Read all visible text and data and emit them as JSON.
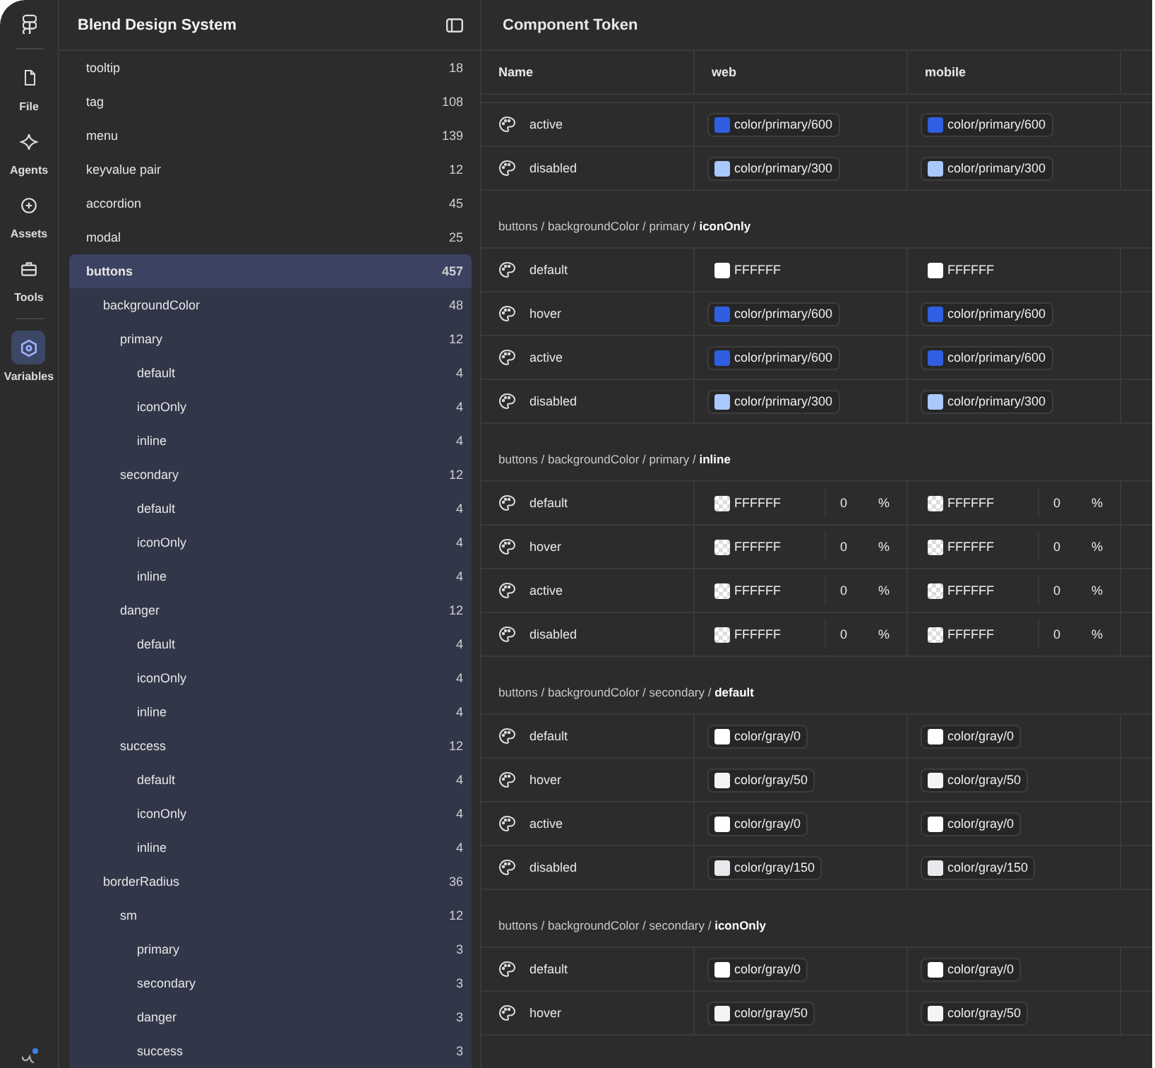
{
  "rail": {
    "items": [
      {
        "label": "File",
        "selected": false,
        "kind": "file"
      },
      {
        "label": "Agents",
        "selected": false,
        "kind": "agents"
      },
      {
        "label": "Assets",
        "selected": false,
        "kind": "assets"
      },
      {
        "label": "Tools",
        "selected": false,
        "kind": "tools"
      },
      {
        "label": "Variables",
        "selected": true,
        "kind": "variables"
      }
    ]
  },
  "sidebar": {
    "title": "Blend Design System",
    "tree": [
      {
        "label": "tooltip",
        "count": "18",
        "selected": false
      },
      {
        "label": "tag",
        "count": "108",
        "selected": false
      },
      {
        "label": "menu",
        "count": "139",
        "selected": false
      },
      {
        "label": "keyvalue pair",
        "count": "12",
        "selected": false
      },
      {
        "label": "accordion",
        "count": "45",
        "selected": false
      },
      {
        "label": "modal",
        "count": "25",
        "selected": false
      },
      {
        "label": "buttons",
        "count": "457",
        "selected": true,
        "children": [
          {
            "label": "backgroundColor",
            "count": "48",
            "selected": false,
            "children": [
              {
                "label": "primary",
                "count": "12",
                "selected": false,
                "children": [
                  {
                    "label": "default",
                    "count": "4",
                    "selected": false
                  },
                  {
                    "label": "iconOnly",
                    "count": "4",
                    "selected": false
                  },
                  {
                    "label": "inline",
                    "count": "4",
                    "selected": false
                  }
                ]
              },
              {
                "label": "secondary",
                "count": "12",
                "selected": false,
                "children": [
                  {
                    "label": "default",
                    "count": "4",
                    "selected": false
                  },
                  {
                    "label": "iconOnly",
                    "count": "4",
                    "selected": false
                  },
                  {
                    "label": "inline",
                    "count": "4",
                    "selected": false
                  }
                ]
              },
              {
                "label": "danger",
                "count": "12",
                "selected": false,
                "children": [
                  {
                    "label": "default",
                    "count": "4",
                    "selected": false
                  },
                  {
                    "label": "iconOnly",
                    "count": "4",
                    "selected": false
                  },
                  {
                    "label": "inline",
                    "count": "4",
                    "selected": false
                  }
                ]
              },
              {
                "label": "success",
                "count": "12",
                "selected": false,
                "children": [
                  {
                    "label": "default",
                    "count": "4",
                    "selected": false
                  },
                  {
                    "label": "iconOnly",
                    "count": "4",
                    "selected": false
                  },
                  {
                    "label": "inline",
                    "count": "4",
                    "selected": false
                  }
                ]
              }
            ]
          },
          {
            "label": "borderRadius",
            "count": "36",
            "selected": false,
            "children": [
              {
                "label": "sm",
                "count": "12",
                "selected": false,
                "children": [
                  {
                    "label": "primary",
                    "count": "3",
                    "selected": false
                  },
                  {
                    "label": "secondary",
                    "count": "3",
                    "selected": false
                  },
                  {
                    "label": "danger",
                    "count": "3",
                    "selected": false
                  },
                  {
                    "label": "success",
                    "count": "3",
                    "selected": false
                  }
                ]
              }
            ]
          }
        ]
      }
    ]
  },
  "main": {
    "title": "Component Token",
    "columns": [
      "Name",
      "web",
      "mobile"
    ],
    "groups": [
      {
        "rows": [
          {
            "name": "active",
            "values": [
              {
                "kind": "token",
                "text": "color/primary/600",
                "color": "#2f5fe0"
              },
              {
                "kind": "token",
                "text": "color/primary/600",
                "color": "#2f5fe0"
              }
            ]
          },
          {
            "name": "disabled",
            "values": [
              {
                "kind": "token",
                "text": "color/primary/300",
                "color": "#a9c8fb"
              },
              {
                "kind": "token",
                "text": "color/primary/300",
                "color": "#a9c8fb"
              }
            ]
          }
        ]
      },
      {
        "path": "buttons / backgroundColor / primary / **iconOnly**",
        "rows": [
          {
            "name": "default",
            "values": [
              {
                "kind": "hex",
                "text": "FFFFFF",
                "color": "#ffffff"
              },
              {
                "kind": "hex",
                "text": "FFFFFF",
                "color": "#ffffff"
              }
            ]
          },
          {
            "name": "hover",
            "values": [
              {
                "kind": "token",
                "text": "color/primary/600",
                "color": "#2f5fe0"
              },
              {
                "kind": "token",
                "text": "color/primary/600",
                "color": "#2f5fe0"
              }
            ]
          },
          {
            "name": "active",
            "values": [
              {
                "kind": "token",
                "text": "color/primary/600",
                "color": "#2f5fe0"
              },
              {
                "kind": "token",
                "text": "color/primary/600",
                "color": "#2f5fe0"
              }
            ]
          },
          {
            "name": "disabled",
            "values": [
              {
                "kind": "token",
                "text": "color/primary/300",
                "color": "#a9c8fb"
              },
              {
                "kind": "token",
                "text": "color/primary/300",
                "color": "#a9c8fb"
              }
            ]
          }
        ]
      },
      {
        "path": "buttons / backgroundColor / primary / **inline**",
        "rows": [
          {
            "name": "default",
            "values": [
              {
                "kind": "alpha",
                "text": "FFFFFF",
                "opacity": "0",
                "unit": "%"
              },
              {
                "kind": "alpha",
                "text": "FFFFFF",
                "opacity": "0",
                "unit": "%"
              }
            ]
          },
          {
            "name": "hover",
            "values": [
              {
                "kind": "alpha",
                "text": "FFFFFF",
                "opacity": "0",
                "unit": "%"
              },
              {
                "kind": "alpha",
                "text": "FFFFFF",
                "opacity": "0",
                "unit": "%"
              }
            ]
          },
          {
            "name": "active",
            "values": [
              {
                "kind": "alpha",
                "text": "FFFFFF",
                "opacity": "0",
                "unit": "%"
              },
              {
                "kind": "alpha",
                "text": "FFFFFF",
                "opacity": "0",
                "unit": "%"
              }
            ]
          },
          {
            "name": "disabled",
            "values": [
              {
                "kind": "alpha",
                "text": "FFFFFF",
                "opacity": "0",
                "unit": "%"
              },
              {
                "kind": "alpha",
                "text": "FFFFFF",
                "opacity": "0",
                "unit": "%"
              }
            ]
          }
        ]
      },
      {
        "path": "buttons / backgroundColor / secondary / **default**",
        "rows": [
          {
            "name": "default",
            "values": [
              {
                "kind": "token",
                "text": "color/gray/0",
                "color": "#ffffff"
              },
              {
                "kind": "token",
                "text": "color/gray/0",
                "color": "#ffffff"
              }
            ]
          },
          {
            "name": "hover",
            "values": [
              {
                "kind": "token",
                "text": "color/gray/50",
                "color": "#f3f4f6"
              },
              {
                "kind": "token",
                "text": "color/gray/50",
                "color": "#f3f4f6"
              }
            ]
          },
          {
            "name": "active",
            "values": [
              {
                "kind": "token",
                "text": "color/gray/0",
                "color": "#ffffff"
              },
              {
                "kind": "token",
                "text": "color/gray/0",
                "color": "#ffffff"
              }
            ]
          },
          {
            "name": "disabled",
            "values": [
              {
                "kind": "token",
                "text": "color/gray/150",
                "color": "#e8e9ec"
              },
              {
                "kind": "token",
                "text": "color/gray/150",
                "color": "#e8e9ec"
              }
            ]
          }
        ]
      },
      {
        "path": "buttons / backgroundColor / secondary / **iconOnly**",
        "rows": [
          {
            "name": "default",
            "values": [
              {
                "kind": "token",
                "text": "color/gray/0",
                "color": "#ffffff"
              },
              {
                "kind": "token",
                "text": "color/gray/0",
                "color": "#ffffff"
              }
            ]
          },
          {
            "name": "hover",
            "values": [
              {
                "kind": "token",
                "text": "color/gray/50",
                "color": "#f3f4f6"
              },
              {
                "kind": "token",
                "text": "color/gray/50",
                "color": "#f3f4f6"
              }
            ]
          }
        ]
      }
    ]
  }
}
